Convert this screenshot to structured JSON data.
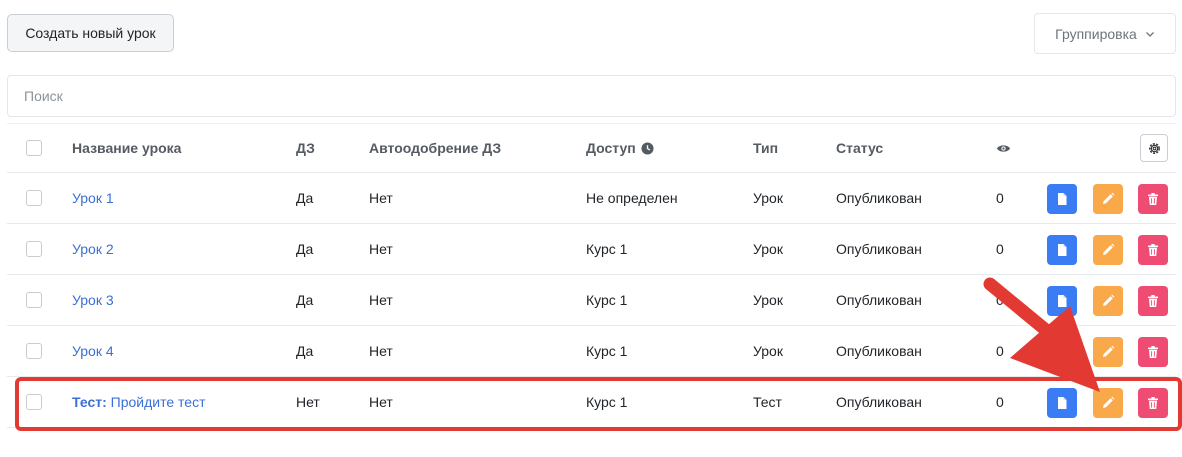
{
  "toolbar": {
    "create_label": "Создать новый урок",
    "group_label": "Группировка"
  },
  "search": {
    "placeholder": "Поиск",
    "value": ""
  },
  "table": {
    "headers": {
      "name": "Название урока",
      "homework": "ДЗ",
      "auto_approve": "Автоодобрение ДЗ",
      "access": "Доступ",
      "type": "Тип",
      "status": "Статус"
    },
    "rows": [
      {
        "name_prefix": "",
        "name": "Урок 1",
        "homework": "Да",
        "auto_approve": "Нет",
        "access": "Не определен",
        "type": "Урок",
        "status": "Опубликован",
        "views": "0"
      },
      {
        "name_prefix": "",
        "name": "Урок 2",
        "homework": "Да",
        "auto_approve": "Нет",
        "access": "Курс 1",
        "type": "Урок",
        "status": "Опубликован",
        "views": "0"
      },
      {
        "name_prefix": "",
        "name": "Урок 3",
        "homework": "Да",
        "auto_approve": "Нет",
        "access": "Курс 1",
        "type": "Урок",
        "status": "Опубликован",
        "views": "0"
      },
      {
        "name_prefix": "",
        "name": "Урок 4",
        "homework": "Да",
        "auto_approve": "Нет",
        "access": "Курс 1",
        "type": "Урок",
        "status": "Опубликован",
        "views": "0"
      },
      {
        "name_prefix": "Тест:",
        "name": "Пройдите тест",
        "homework": "Нет",
        "auto_approve": "Нет",
        "access": "Курс 1",
        "type": "Тест",
        "status": "Опубликован",
        "views": "0"
      }
    ]
  },
  "icons": {
    "access_header": "clock-icon",
    "views_header": "eye-icon",
    "settings": "gear-icon",
    "row_actions": [
      "document-icon",
      "pencil-icon",
      "trash-icon"
    ]
  },
  "colors": {
    "link": "#3b6fd6",
    "doc_button": "#3a7cf3",
    "edit_button": "#f9a84a",
    "delete_button": "#ef4c74",
    "annotation": "#e23a33"
  }
}
